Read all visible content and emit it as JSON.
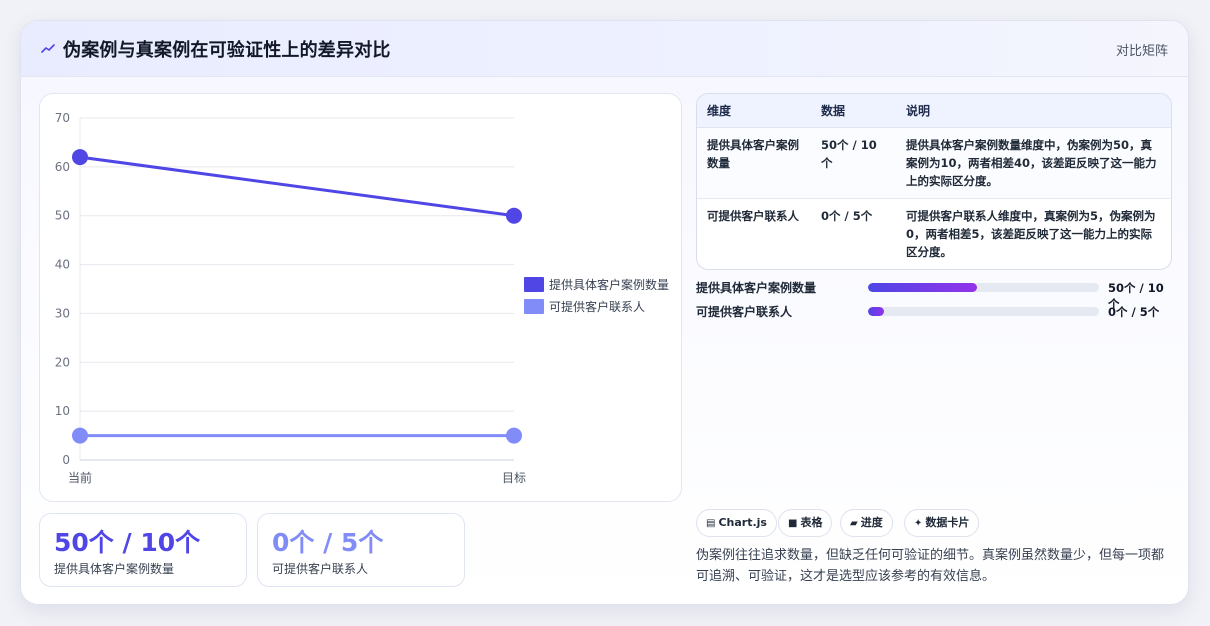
{
  "header": {
    "title": "伪案例与真案例在可验证性上的差异对比",
    "right_label": "对比矩阵",
    "icon": "chart-line-icon"
  },
  "chart_data": {
    "type": "line",
    "categories": [
      "当前",
      "目标"
    ],
    "series": [
      {
        "name": "提供具体客户案例数量",
        "values": [
          62,
          50
        ],
        "color": "#4f46e5"
      },
      {
        "name": "可提供客户联系人",
        "values": [
          5,
          5
        ],
        "color": "#818cf8"
      }
    ],
    "ylim": [
      0,
      70
    ],
    "yticks": [
      0,
      10,
      20,
      30,
      40,
      50,
      60,
      70
    ],
    "grid": true,
    "legend": "right"
  },
  "stats": [
    {
      "value": "50个 / 10个",
      "label": "提供具体客户案例数量"
    },
    {
      "value": "0个 / 5个",
      "label": "可提供客户联系人"
    }
  ],
  "table": {
    "headers": [
      "维度",
      "数据",
      "说明"
    ],
    "rows": [
      {
        "dimension": "提供具体客户案例数量",
        "data": "50个 / 10个",
        "note": "提供具体客户案例数量维度中，伪案例为50，真案例为10，两者相差40，该差距反映了这一能力上的实际区分度。"
      },
      {
        "dimension": "可提供客户联系人",
        "data": "0个 / 5个",
        "note": "可提供客户联系人维度中，真案例为5，伪案例为0，两者相差5，该差距反映了这一能力上的实际区分度。"
      }
    ]
  },
  "progress": [
    {
      "label": "提供具体客户案例数量",
      "value": "50个 / 10个",
      "fraction": 0.47
    },
    {
      "label": "可提供客户联系人",
      "value": "0个 / 5个",
      "fraction": 0.07
    }
  ],
  "tags": [
    {
      "icon": "chart-icon",
      "glyph": "▤",
      "label": "Chart.js"
    },
    {
      "icon": "table-icon",
      "glyph": "■",
      "label": "表格"
    },
    {
      "icon": "progress-icon",
      "glyph": "▰",
      "label": "进度"
    },
    {
      "icon": "sparkle-icon",
      "glyph": "✦",
      "label": "数据卡片"
    }
  ],
  "summary": "伪案例往往追求数量，但缺乏任何可验证的细节。真案例虽然数量少，但每一项都可追溯、可验证，这才是选型应该参考的有效信息。"
}
